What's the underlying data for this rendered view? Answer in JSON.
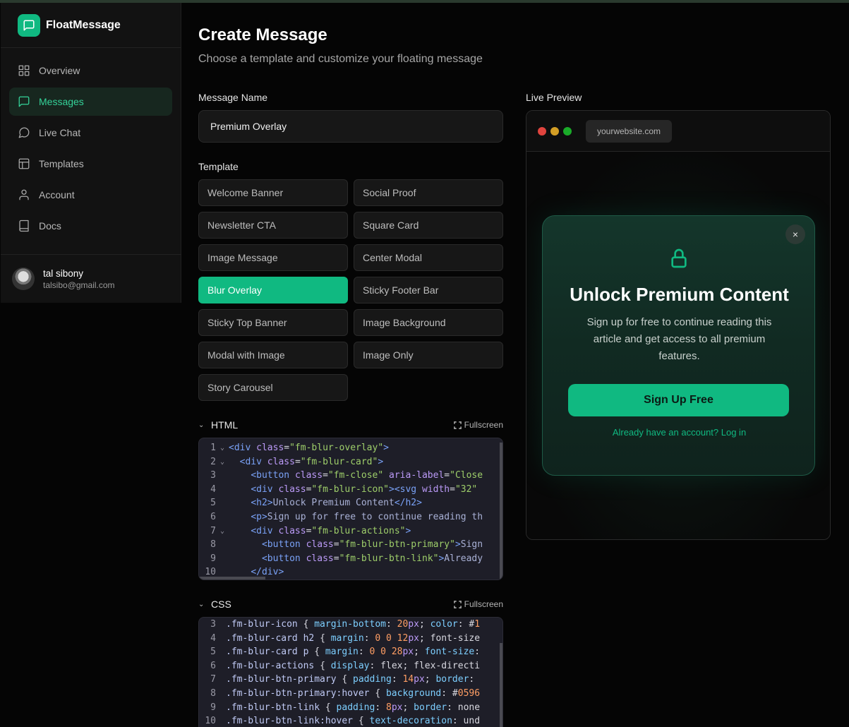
{
  "app": {
    "name": "FloatMessage"
  },
  "sidebar": {
    "items": [
      {
        "label": "Overview",
        "icon": "grid-icon"
      },
      {
        "label": "Messages",
        "icon": "message-square-icon",
        "active": true
      },
      {
        "label": "Live Chat",
        "icon": "chat-bubble-icon"
      },
      {
        "label": "Templates",
        "icon": "layout-icon"
      },
      {
        "label": "Account",
        "icon": "user-icon"
      },
      {
        "label": "Docs",
        "icon": "book-icon"
      }
    ]
  },
  "user": {
    "name": "tal sibony",
    "email": "talsibo@gmail.com"
  },
  "page": {
    "title": "Create Message",
    "subtitle": "Choose a template and customize your floating message"
  },
  "form": {
    "name_label": "Message Name",
    "name_value": "Premium Overlay",
    "template_label": "Template",
    "templates": [
      "Welcome Banner",
      "Social Proof",
      "Newsletter CTA",
      "Square Card",
      "Image Message",
      "Center Modal",
      "Blur Overlay",
      "Sticky Footer Bar",
      "Sticky Top Banner",
      "Image Background",
      "Modal with Image",
      "Image Only",
      "Story Carousel"
    ],
    "selected_template": "Blur Overlay"
  },
  "html_editor": {
    "title": "HTML",
    "fullscreen_label": "Fullscreen",
    "lines": [
      {
        "n": "1",
        "fold": true,
        "code": "<div class=\"fm-blur-overlay\">"
      },
      {
        "n": "2",
        "fold": true,
        "code": "  <div class=\"fm-blur-card\">"
      },
      {
        "n": "3",
        "fold": false,
        "code": "    <button class=\"fm-close\" aria-label=\"Close"
      },
      {
        "n": "4",
        "fold": false,
        "code": "    <div class=\"fm-blur-icon\"><svg width=\"32\""
      },
      {
        "n": "5",
        "fold": false,
        "code": "    <h2>Unlock Premium Content</h2>"
      },
      {
        "n": "6",
        "fold": false,
        "code": "    <p>Sign up for free to continue reading th"
      },
      {
        "n": "7",
        "fold": true,
        "code": "    <div class=\"fm-blur-actions\">"
      },
      {
        "n": "8",
        "fold": false,
        "code": "      <button class=\"fm-blur-btn-primary\">Sign"
      },
      {
        "n": "9",
        "fold": false,
        "code": "      <button class=\"fm-blur-btn-link\">Already"
      },
      {
        "n": "10",
        "fold": false,
        "code": "    </div>"
      }
    ]
  },
  "css_editor": {
    "title": "CSS",
    "fullscreen_label": "Fullscreen",
    "lines": [
      {
        "n": "3",
        "code": ".fm-blur-icon { margin-bottom: 20px; color: #1"
      },
      {
        "n": "4",
        "code": ".fm-blur-card h2 { margin: 0 0 12px; font-size"
      },
      {
        "n": "5",
        "code": ".fm-blur-card p { margin: 0 0 28px; font-size:"
      },
      {
        "n": "6",
        "code": ".fm-blur-actions { display: flex; flex-directi"
      },
      {
        "n": "7",
        "code": ".fm-blur-btn-primary { padding: 14px; border: "
      },
      {
        "n": "8",
        "code": ".fm-blur-btn-primary:hover { background: #0596"
      },
      {
        "n": "9",
        "code": ".fm-blur-btn-link { padding: 8px; border: none"
      },
      {
        "n": "10",
        "code": ".fm-blur-btn-link:hover { text-decoration: und"
      }
    ]
  },
  "preview": {
    "label": "Live Preview",
    "url": "yourwebsite.com",
    "card": {
      "close": "×",
      "title": "Unlock Premium Content",
      "text": "Sign up for free to continue reading this article and get access to all premium features.",
      "button": "Sign Up Free",
      "link": "Already have an account? Log in"
    }
  },
  "colors": {
    "accent": "#10b981",
    "background": "#050505",
    "sidebar": "#121212",
    "mac_red": "#e0443e",
    "mac_yellow": "#d39e25",
    "mac_green": "#1aab29"
  }
}
